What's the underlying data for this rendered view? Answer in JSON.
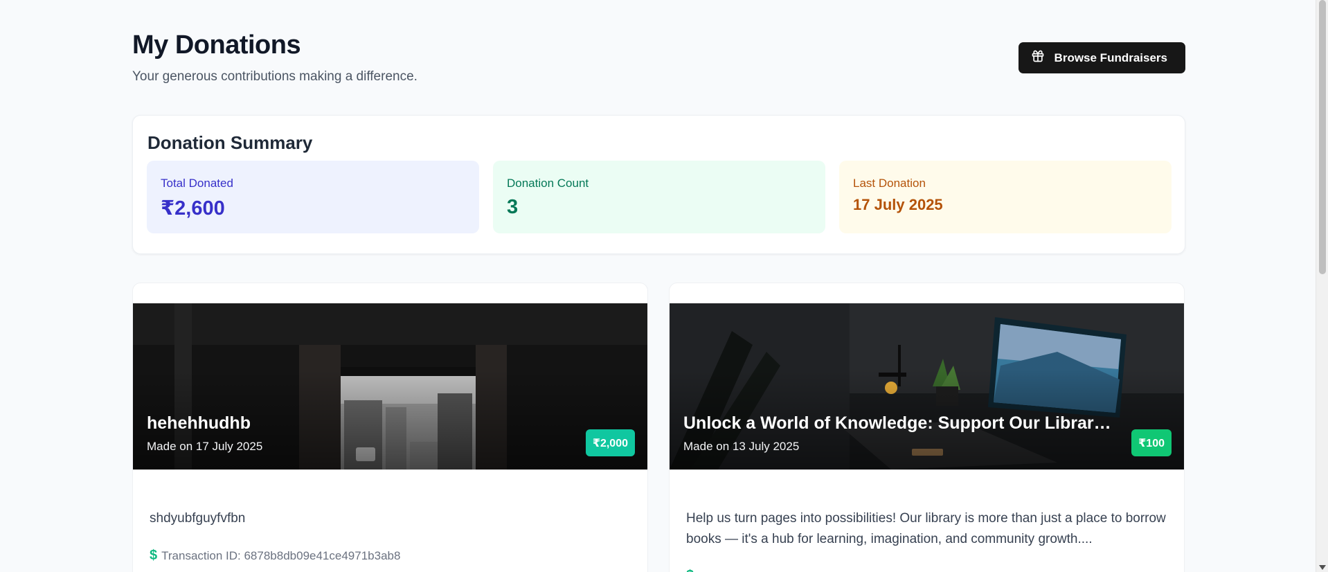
{
  "header": {
    "title": "My Donations",
    "subtitle": "Your generous contributions making a difference.",
    "browse_button": {
      "label": "Browse Fundraisers",
      "icon": "gift-icon"
    }
  },
  "summary": {
    "title": "Donation Summary",
    "stats": [
      {
        "label": "Total Donated",
        "value": "₹2,600",
        "color": "#3730c9"
      },
      {
        "label": "Donation Count",
        "value": "3",
        "color": "#047857"
      },
      {
        "label": "Last Donation",
        "value": "17 July 2025",
        "color": "#b45309"
      }
    ]
  },
  "donations": [
    {
      "title": "hehehhudhb",
      "date": "Made on 17 July 2025",
      "amount": "₹2,000",
      "badge_color": "#10c7a0",
      "description": "shdyubfguyfvfbn",
      "transaction": "Transaction ID: 6878b8db09e41ce4971b3ab8"
    },
    {
      "title": "Unlock a World of Knowledge: Support Our Library...",
      "date": "Made on 13 July 2025",
      "amount": "₹100",
      "badge_color": "#10c774",
      "description": "Help us turn pages into possibilities! Our library is more than just a place to borrow books — it's a hub for learning, imagination, and community growth...."
    }
  ]
}
